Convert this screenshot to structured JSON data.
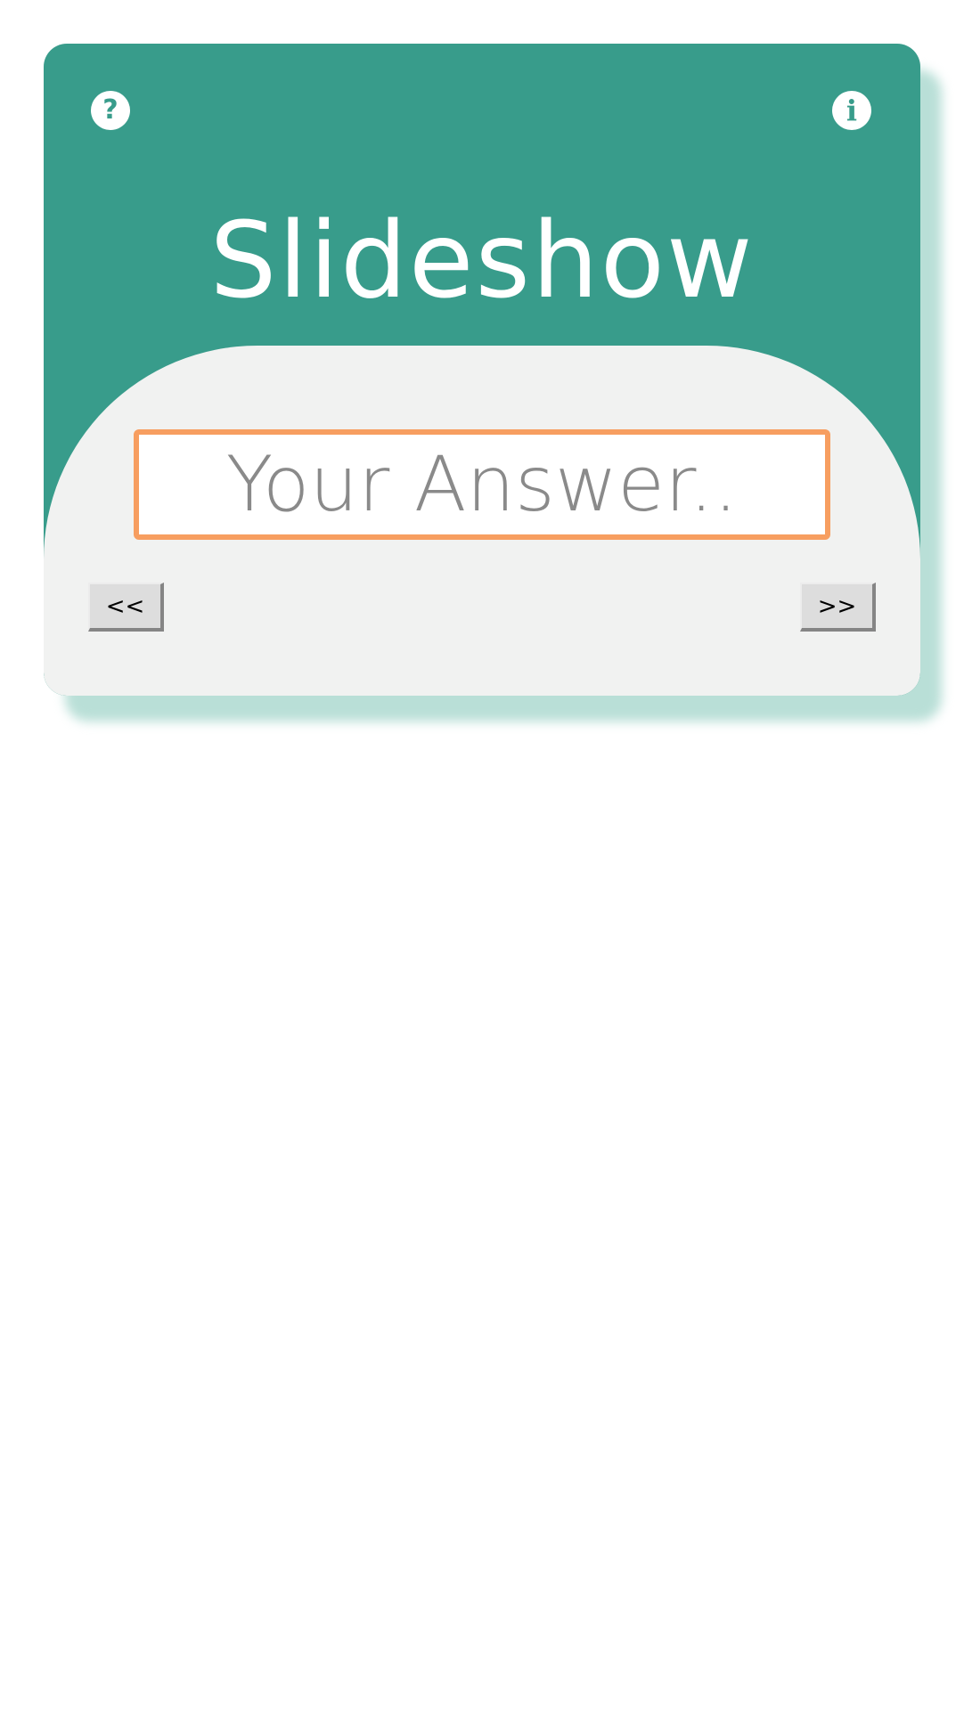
{
  "app": {
    "title": "Slideshow"
  },
  "icons": {
    "help": "?",
    "info": "i"
  },
  "answer": {
    "placeholder": "Your Answer..",
    "value": ""
  },
  "navigation": {
    "prev_label": "<<",
    "next_label": ">>"
  },
  "colors": {
    "header": "#389c8b",
    "body": "#f1f2f1",
    "input_border": "#f79e60",
    "shadow": "#b9dfd7"
  }
}
